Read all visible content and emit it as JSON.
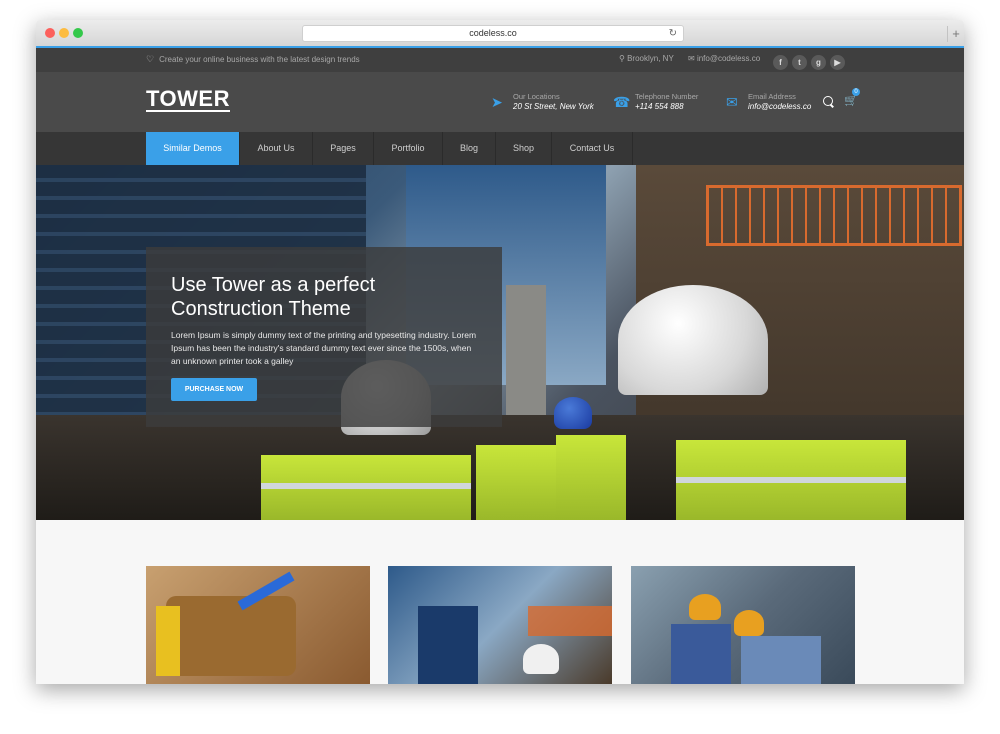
{
  "browser": {
    "url": "codeless.co",
    "reload": "↻",
    "new_tab": "+"
  },
  "topbar": {
    "tagline": "Create your online business with the latest design trends",
    "location": "Brooklyn, NY",
    "email": "info@codeless.co",
    "socials": [
      "f",
      "t",
      "g",
      "▶"
    ]
  },
  "header": {
    "logo": "TOWER",
    "info": [
      {
        "label": "Our Locations",
        "value": "20 St Street, New York",
        "icon": "location-arrow-icon"
      },
      {
        "label": "Telephone Number",
        "value": "+114 554 888",
        "icon": "phone-icon"
      },
      {
        "label": "Email Address",
        "value": "info@codeless.co",
        "icon": "envelope-icon"
      }
    ],
    "cart_count": "0"
  },
  "nav": {
    "items": [
      "Similar Demos",
      "About Us",
      "Pages",
      "Portfolio",
      "Blog",
      "Shop",
      "Contact Us"
    ]
  },
  "hero": {
    "title": "Use Tower as a perfect Construction Theme",
    "text": "Lorem Ipsum is simply dummy text of the printing and typesetting industry. Lorem Ipsum has been the industry's standard dummy text ever since the 1500s, when an unknown printer took a galley",
    "button": "PURCHASE NOW"
  },
  "colors": {
    "accent": "#3aa0e8",
    "topbar": "#3f3f3f",
    "header": "#4a4a4a",
    "nav": "#363636"
  }
}
